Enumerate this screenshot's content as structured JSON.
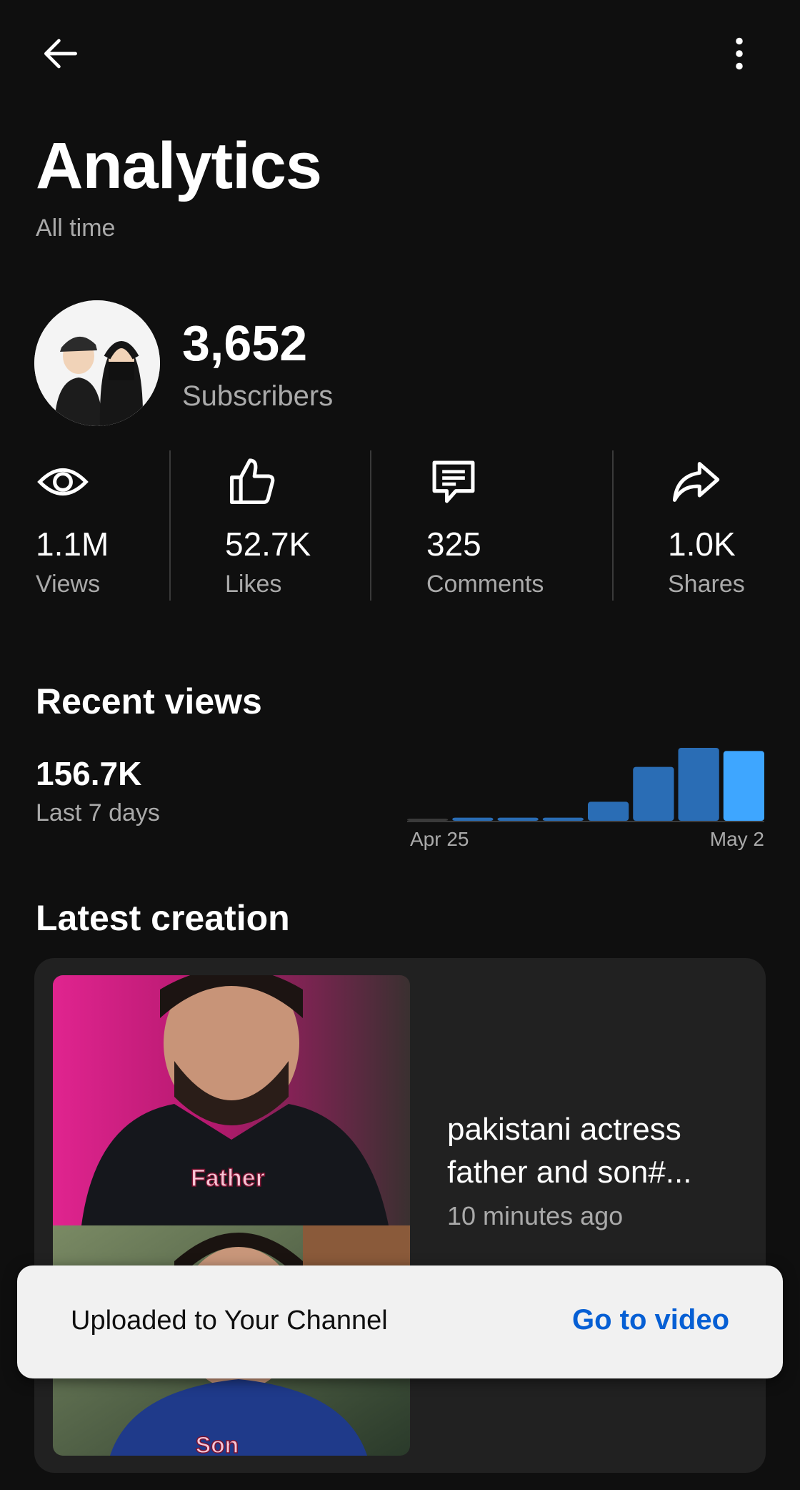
{
  "header": {
    "back_icon": "arrow-left-icon",
    "more_icon": "more-vert-icon",
    "title": "Analytics",
    "period": "All time"
  },
  "channel": {
    "subscribers_value": "3,652",
    "subscribers_label": "Subscribers"
  },
  "stats": [
    {
      "icon": "eye-icon",
      "value": "1.1M",
      "label": "Views"
    },
    {
      "icon": "thumb-up-icon",
      "value": "52.7K",
      "label": "Likes"
    },
    {
      "icon": "comment-icon",
      "value": "325",
      "label": "Comments"
    },
    {
      "icon": "share-icon",
      "value": "1.0K",
      "label": "Shares"
    }
  ],
  "recent_views": {
    "title": "Recent views",
    "value": "156.7K",
    "label": "Last 7 days"
  },
  "chart_data": {
    "type": "bar",
    "x_start_label": "Apr 25",
    "x_end_label": "May 2",
    "values": [
      1,
      2,
      2,
      2,
      12,
      34,
      46,
      44
    ],
    "colors": [
      "#3a3a3a",
      "#2a6db5",
      "#2a6db5",
      "#2a6db5",
      "#2a6db5",
      "#2a6db5",
      "#2a6db5",
      "#3ea6ff"
    ]
  },
  "latest_creation": {
    "title": "Latest creation",
    "video_title": "pakistani actress father and son#...",
    "video_time": "10 minutes ago",
    "thumb_caption_top": "Father",
    "thumb_caption_bottom": "Son"
  },
  "snackbar": {
    "text": "Uploaded to Your Channel",
    "action": "Go to video"
  }
}
